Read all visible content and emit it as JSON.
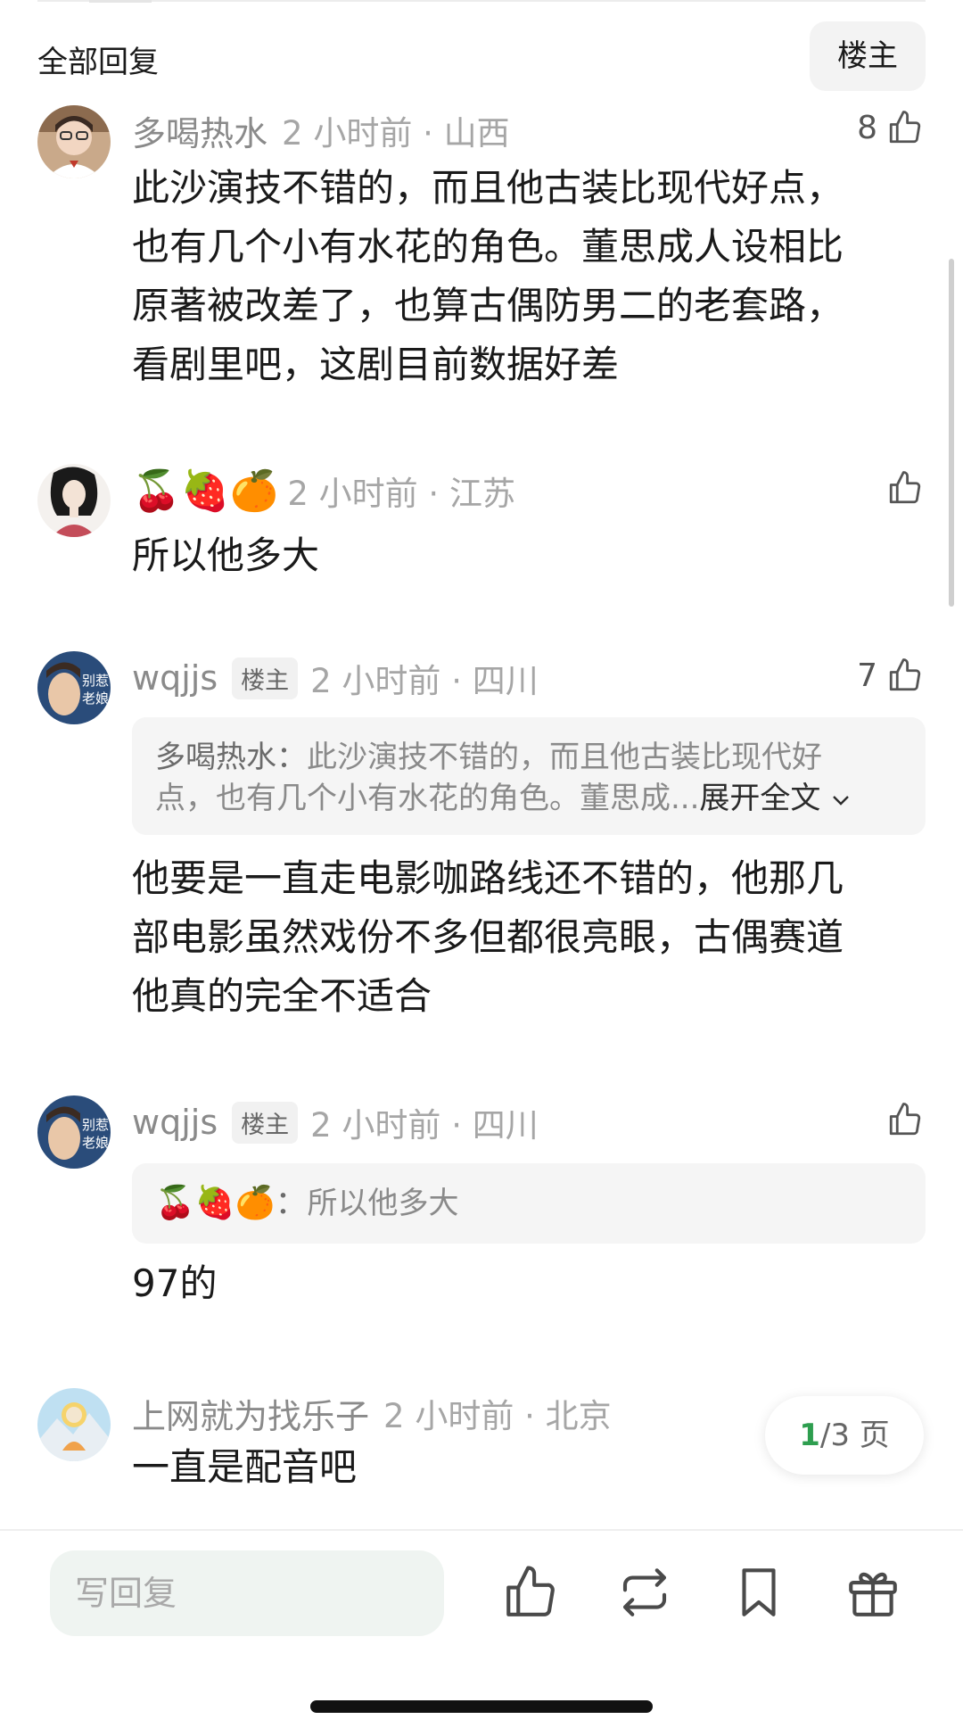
{
  "header": {
    "title": "全部回复",
    "owner_button": "楼主"
  },
  "comments": [
    {
      "username": "多喝热水",
      "time_location": "2 小时前 · 山西",
      "likes": "8",
      "text_lines": [
        "此沙演技不错的，而且他古装比现代好点，",
        "也有几个小有水花的角色。董思成人设相比",
        "原著被改差了，也算古偶防男二的老套路，",
        "看剧里吧，这剧目前数据好差"
      ]
    },
    {
      "username_emoji": "🍒🍓🍊",
      "time_location": "2 小时前 · 江苏",
      "likes": "",
      "text": "所以他多大"
    },
    {
      "username": "wqjjs",
      "badge": "楼主",
      "time_location": "2 小时前 · 四川",
      "likes": "7",
      "quote": {
        "name": "多喝热水：",
        "line1": "此沙演技不错的，而且他古装比现代好",
        "line2": "点，也有几个小有水花的角色。董思成...",
        "expand": "展开全文"
      },
      "avatar_text_1": "别惹",
      "avatar_text_2": "老娘",
      "text_lines": [
        "他要是一直走电影咖路线还不错的，他那几",
        "部电影虽然戏份不多但都很亮眼，古偶赛道",
        "他真的完全不适合"
      ]
    },
    {
      "username": "wqjjs",
      "badge": "楼主",
      "time_location": "2 小时前 · 四川",
      "likes": "",
      "quote": {
        "name": "🍒🍓🍊：",
        "text": "所以他多大"
      },
      "avatar_text_1": "别惹",
      "avatar_text_2": "老娘",
      "text": "97的"
    },
    {
      "username": "上网就为找乐子",
      "time_location": "2 小时前 · 北京",
      "text": "一直是配音吧"
    }
  ],
  "pager": {
    "current": "1",
    "rest": "/3 页"
  },
  "bottom_bar": {
    "reply_placeholder": "写回复",
    "icons": [
      "like-icon",
      "repost-icon",
      "bookmark-icon",
      "gift-icon"
    ]
  },
  "colors": {
    "accent_green": "#2e9e4f",
    "muted_text": "#a0a0a0"
  }
}
